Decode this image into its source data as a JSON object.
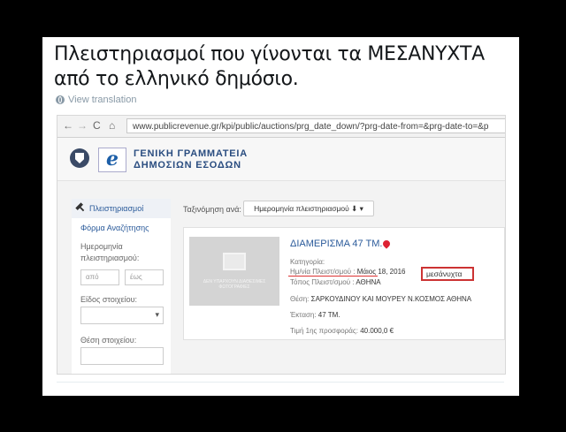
{
  "tweet": {
    "text": "Πλειστηριασμοί που γίνονται τα ΜΕΣΑΝΥΧΤΑ από το ελληνικό δημόσιο.",
    "translate_label": "View translation"
  },
  "browser": {
    "url": "www.publicrevenue.gr/kpi/public/auctions/prg_date_down/?prg-date-from=&prg-date-to=&p"
  },
  "site": {
    "org_line1": "ΓΕΝΙΚΗ ΓΡΑΜΜΑΤΕΙΑ",
    "org_line2": "ΔΗΜΟΣΙΩΝ ΕΣΟΔΩΝ",
    "logo_letter": "e"
  },
  "sidebar": {
    "active_item": "Πλειστηριασμοί",
    "search_form": "Φόρμα Αναζήτησης",
    "date_label": "Ημερομηνία πλειστηριασμού:",
    "from_placeholder": "από",
    "to_placeholder": "έως",
    "type_label": "Είδος στοιχείου:",
    "location_label": "Θέση στοιχείου:"
  },
  "sort": {
    "label": "Ταξινόμηση ανά:",
    "value": "Ημερομηνία πλειστηριασμού ⬇ ▾"
  },
  "listing": {
    "title": "ΔΙΑΜΕΡΙΣΜΑ 47 ΤΜ.",
    "photo_text": "ΔΕΝ ΥΠΑΡΧΟΥΝ ΔΙΑΘΕΣΙΜΕΣ ΦΩΤΟΓΡΑΦΙΕΣ",
    "category_label": "Κατηγορία:",
    "date_label": "Ημ/νία Πλειστ/σμού :",
    "date_value": "Μάιος 18, 2016",
    "time_value": "μεσάνυχτα",
    "place_label": "Τόπος Πλειστ/σμού :",
    "place_value": "ΑΘΗΝΑ",
    "location_label": "Θέση:",
    "location_value": "ΣΑΡΚΟΥΔΙΝΟΥ ΚΑΙ ΜΟΥΡΕΥ Ν.ΚΟΣΜΟΣ ΑΘΗΝΑ",
    "area_label": "Έκταση:",
    "area_value": "47 ΤΜ.",
    "price_label": "Τιμή 1ης προσφοράς:",
    "price_value": "40.000,0 €"
  },
  "colors": {
    "link_blue": "#2a5a9a",
    "highlight_red": "#cc3333"
  }
}
